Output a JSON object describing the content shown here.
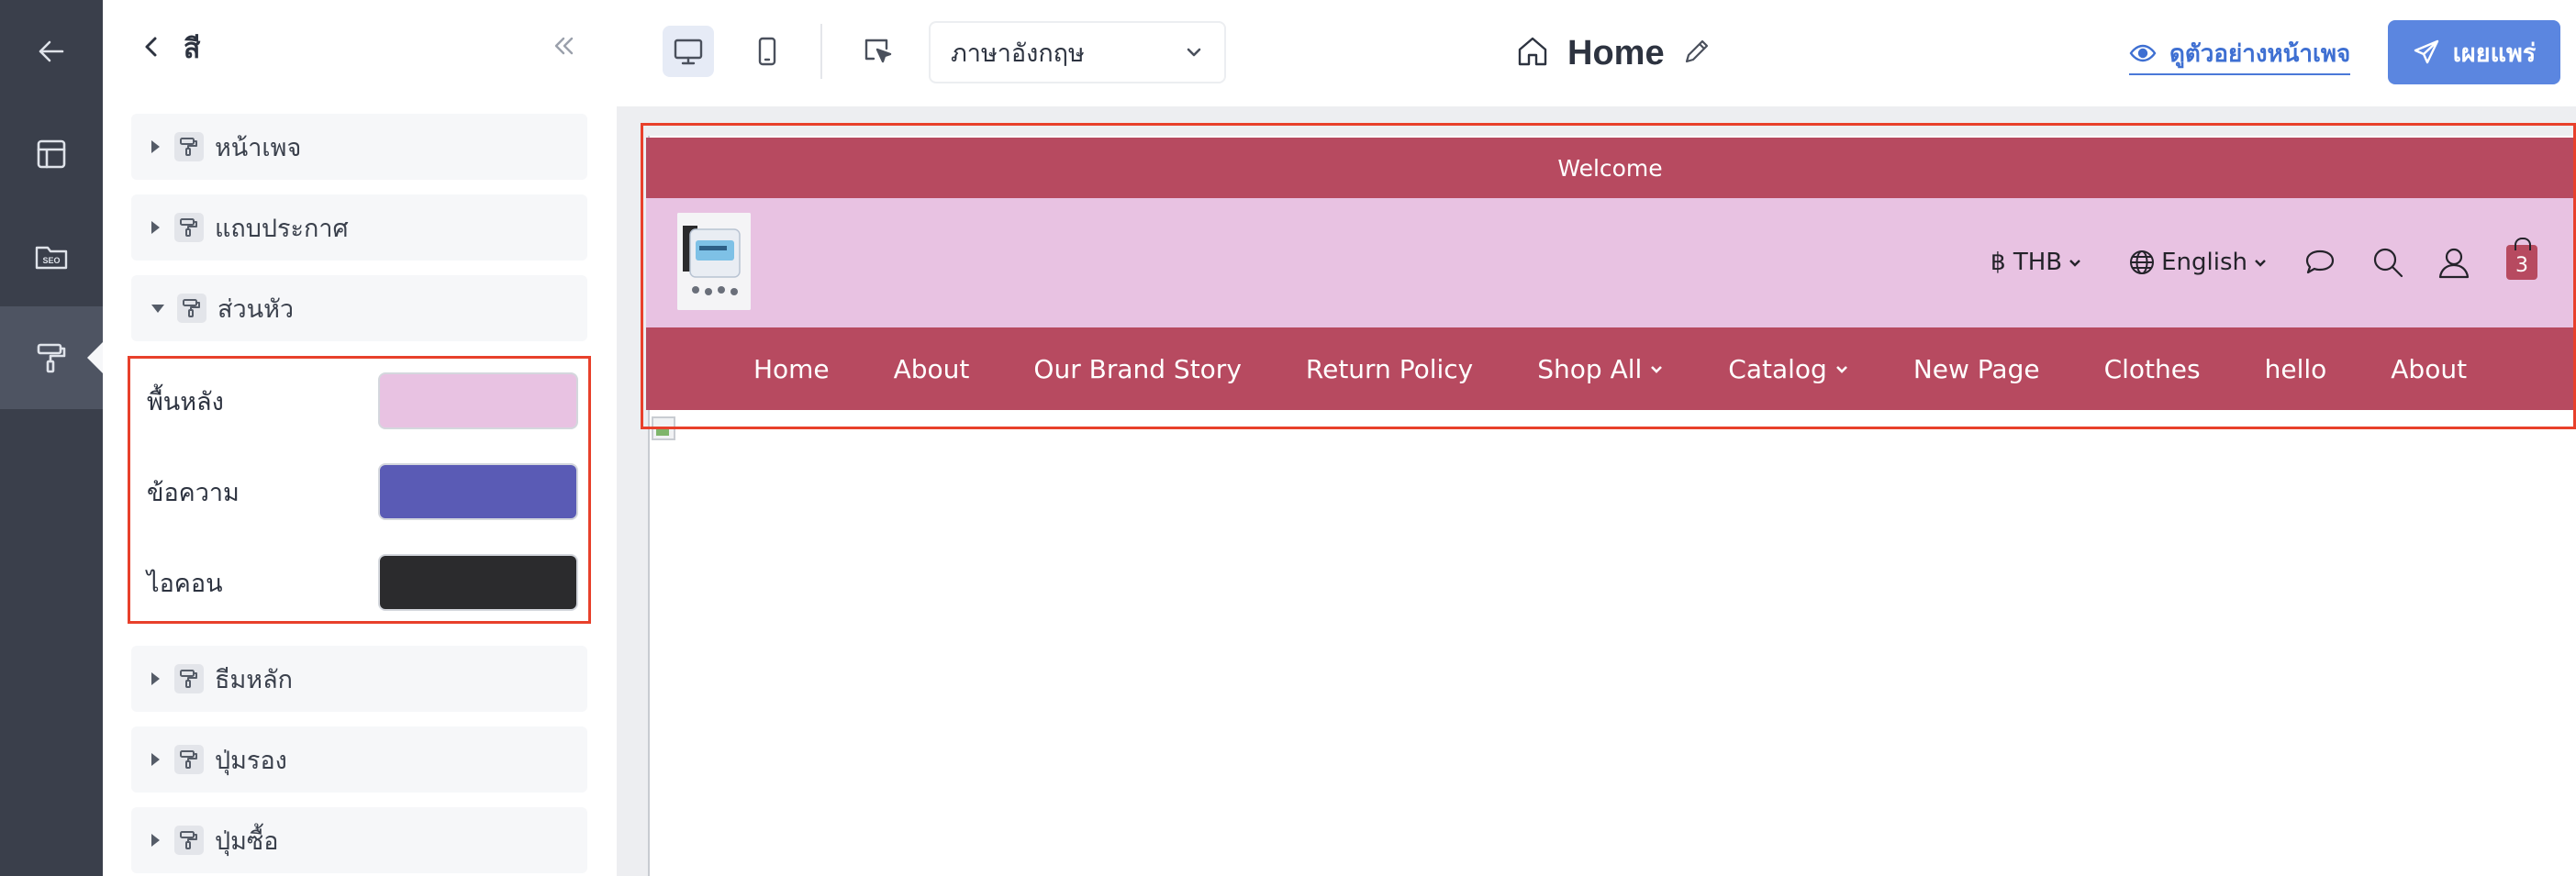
{
  "panel": {
    "title": "สี",
    "sections_top": [
      {
        "label": "หน้าเพจ"
      },
      {
        "label": "แถบประกาศ"
      },
      {
        "label": "ส่วนหัว"
      }
    ],
    "colors": [
      {
        "label": "พื้นหลัง",
        "value": "#E8C2E2"
      },
      {
        "label": "ข้อความ",
        "value": "#5A5BB5"
      },
      {
        "label": "ไอคอน",
        "value": "#2B2B2D"
      }
    ],
    "sections_bottom": [
      {
        "label": "ธีมหลัก"
      },
      {
        "label": "ปุ่มรอง"
      },
      {
        "label": "ปุ่มซื้อ"
      }
    ]
  },
  "rail": {
    "icons": [
      "back-arrow-icon",
      "layout-icon",
      "seo-icon",
      "paint-roller-icon"
    ],
    "seo_label": "SEO"
  },
  "toolbar": {
    "language_select": "ภาษาอังกฤษ",
    "page_title": "Home",
    "preview_label": "ดูตัวอย่างหน้าเพจ",
    "publish_label": "เผยแพร่"
  },
  "site": {
    "announcement": "Welcome",
    "currency": "฿ THB",
    "language": "English",
    "cart_count": "3",
    "nav": [
      {
        "label": "Home",
        "dropdown": false
      },
      {
        "label": "About",
        "dropdown": false
      },
      {
        "label": "Our Brand Story",
        "dropdown": false
      },
      {
        "label": "Return Policy",
        "dropdown": false
      },
      {
        "label": "Shop All",
        "dropdown": true
      },
      {
        "label": "Catalog",
        "dropdown": true
      },
      {
        "label": "New Page",
        "dropdown": false
      },
      {
        "label": "Clothes",
        "dropdown": false
      },
      {
        "label": "hello",
        "dropdown": false
      },
      {
        "label": "About",
        "dropdown": false
      }
    ],
    "colors": {
      "announcement_bg": "#B74A60",
      "header_bg": "#E8C2E2",
      "nav_bg": "#B74A60"
    }
  }
}
